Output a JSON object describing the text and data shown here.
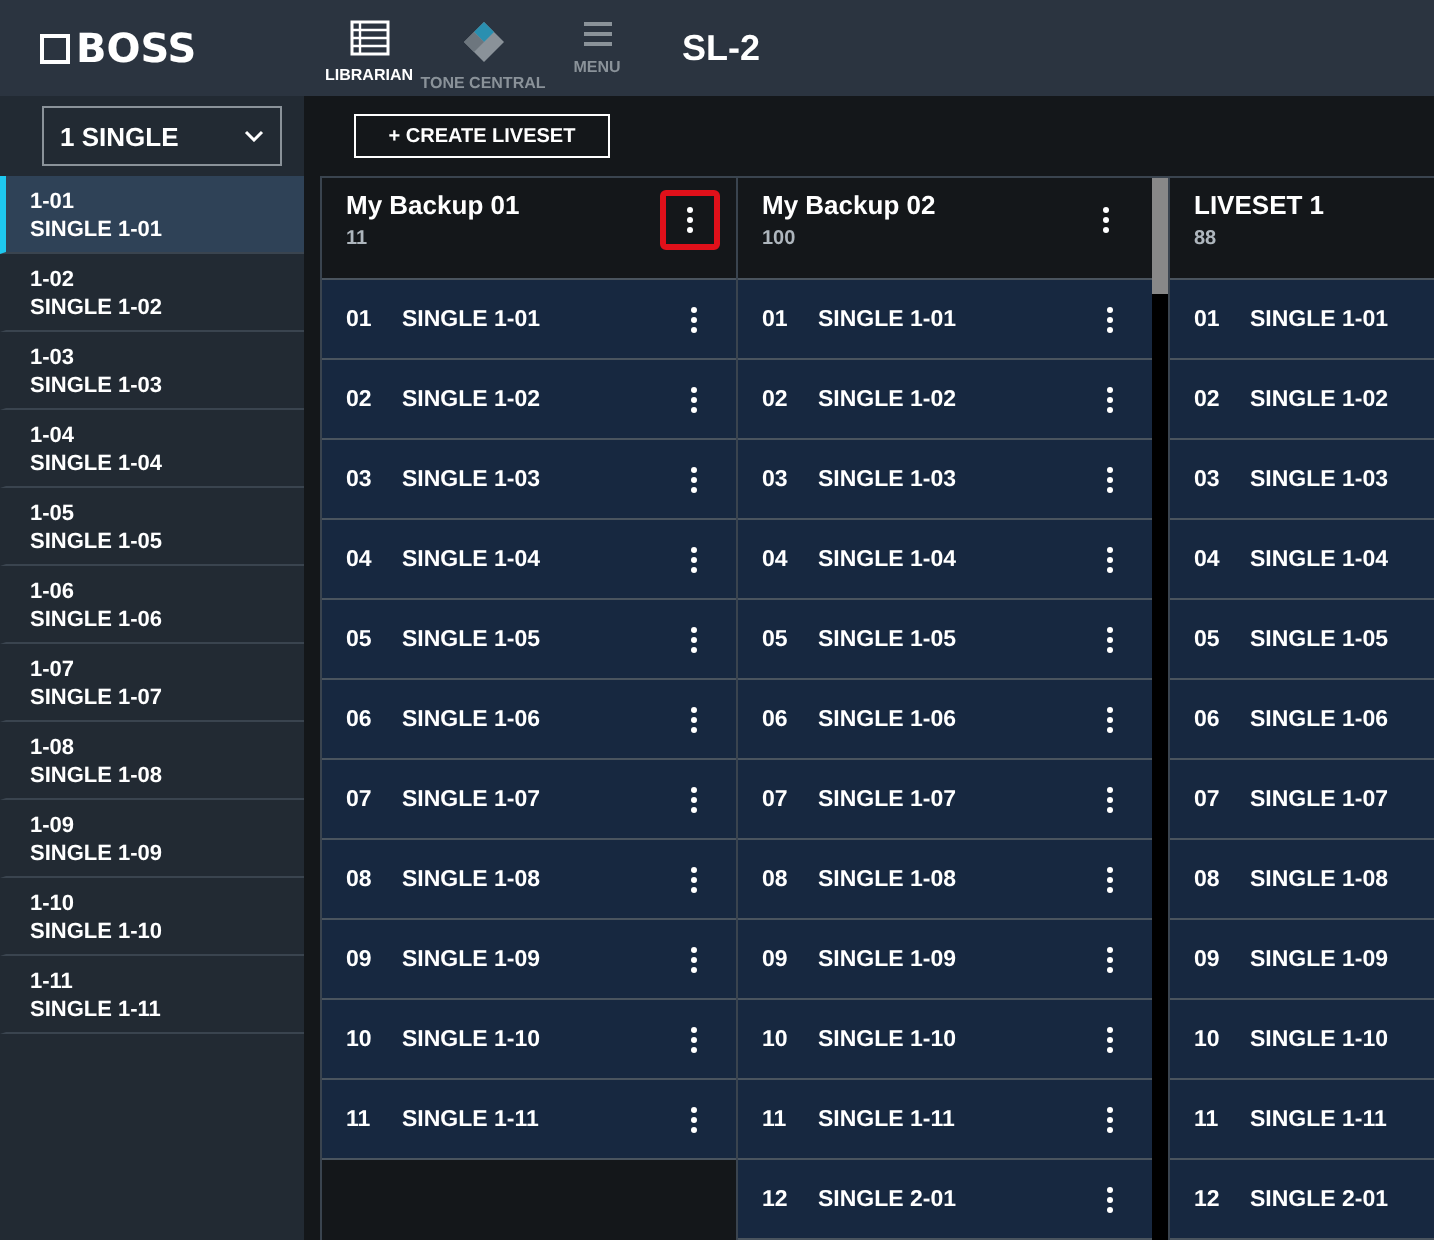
{
  "header": {
    "logo": "BOSS",
    "nav": [
      {
        "label": "LIBRARIAN",
        "selected": true
      },
      {
        "label": "TONE CENTRAL",
        "selected": false
      },
      {
        "label": "MENU",
        "selected": false
      }
    ],
    "device": "SL-2"
  },
  "sidebar": {
    "dropdown": "1 SINGLE",
    "items": [
      {
        "number": "1-01",
        "name": "SINGLE 1-01",
        "selected": true
      },
      {
        "number": "1-02",
        "name": "SINGLE 1-02",
        "selected": false
      },
      {
        "number": "1-03",
        "name": "SINGLE 1-03",
        "selected": false
      },
      {
        "number": "1-04",
        "name": "SINGLE 1-04",
        "selected": false
      },
      {
        "number": "1-05",
        "name": "SINGLE 1-05",
        "selected": false
      },
      {
        "number": "1-06",
        "name": "SINGLE 1-06",
        "selected": false
      },
      {
        "number": "1-07",
        "name": "SINGLE 1-07",
        "selected": false
      },
      {
        "number": "1-08",
        "name": "SINGLE 1-08",
        "selected": false
      },
      {
        "number": "1-09",
        "name": "SINGLE 1-09",
        "selected": false
      },
      {
        "number": "1-10",
        "name": "SINGLE 1-10",
        "selected": false
      },
      {
        "number": "1-11",
        "name": "SINGLE 1-11",
        "selected": false
      }
    ]
  },
  "create_button": "+ CREATE LIVESET",
  "livesets": [
    {
      "title": "My Backup 01",
      "count": "11",
      "menu": true,
      "highlighted": true,
      "row_menus": true,
      "scrollbar": false,
      "rows": [
        {
          "number": "01",
          "name": "SINGLE 1-01"
        },
        {
          "number": "02",
          "name": "SINGLE 1-02"
        },
        {
          "number": "03",
          "name": "SINGLE 1-03"
        },
        {
          "number": "04",
          "name": "SINGLE 1-04"
        },
        {
          "number": "05",
          "name": "SINGLE 1-05"
        },
        {
          "number": "06",
          "name": "SINGLE 1-06"
        },
        {
          "number": "07",
          "name": "SINGLE 1-07"
        },
        {
          "number": "08",
          "name": "SINGLE 1-08"
        },
        {
          "number": "09",
          "name": "SINGLE 1-09"
        },
        {
          "number": "10",
          "name": "SINGLE 1-10"
        },
        {
          "number": "11",
          "name": "SINGLE 1-11"
        }
      ]
    },
    {
      "title": "My Backup 02",
      "count": "100",
      "menu": true,
      "highlighted": false,
      "row_menus": true,
      "scrollbar": true,
      "rows": [
        {
          "number": "01",
          "name": "SINGLE 1-01"
        },
        {
          "number": "02",
          "name": "SINGLE 1-02"
        },
        {
          "number": "03",
          "name": "SINGLE 1-03"
        },
        {
          "number": "04",
          "name": "SINGLE 1-04"
        },
        {
          "number": "05",
          "name": "SINGLE 1-05"
        },
        {
          "number": "06",
          "name": "SINGLE 1-06"
        },
        {
          "number": "07",
          "name": "SINGLE 1-07"
        },
        {
          "number": "08",
          "name": "SINGLE 1-08"
        },
        {
          "number": "09",
          "name": "SINGLE 1-09"
        },
        {
          "number": "10",
          "name": "SINGLE 1-10"
        },
        {
          "number": "11",
          "name": "SINGLE 1-11"
        },
        {
          "number": "12",
          "name": "SINGLE 2-01"
        }
      ]
    },
    {
      "title": "LIVESET 1",
      "count": "88",
      "rows": [
        {
          "number": "01",
          "name": "SINGLE 1-01"
        },
        {
          "number": "02",
          "name": "SINGLE 1-02"
        },
        {
          "number": "03",
          "name": "SINGLE 1-03"
        },
        {
          "number": "04",
          "name": "SINGLE 1-04"
        },
        {
          "number": "05",
          "name": "SINGLE 1-05"
        },
        {
          "number": "06",
          "name": "SINGLE 1-06"
        },
        {
          "number": "07",
          "name": "SINGLE 1-07"
        },
        {
          "number": "08",
          "name": "SINGLE 1-08"
        },
        {
          "number": "09",
          "name": "SINGLE 1-09"
        },
        {
          "number": "10",
          "name": "SINGLE 1-10"
        },
        {
          "number": "11",
          "name": "SINGLE 1-11"
        },
        {
          "number": "12",
          "name": "SINGLE 2-01"
        }
      ]
    }
  ]
}
